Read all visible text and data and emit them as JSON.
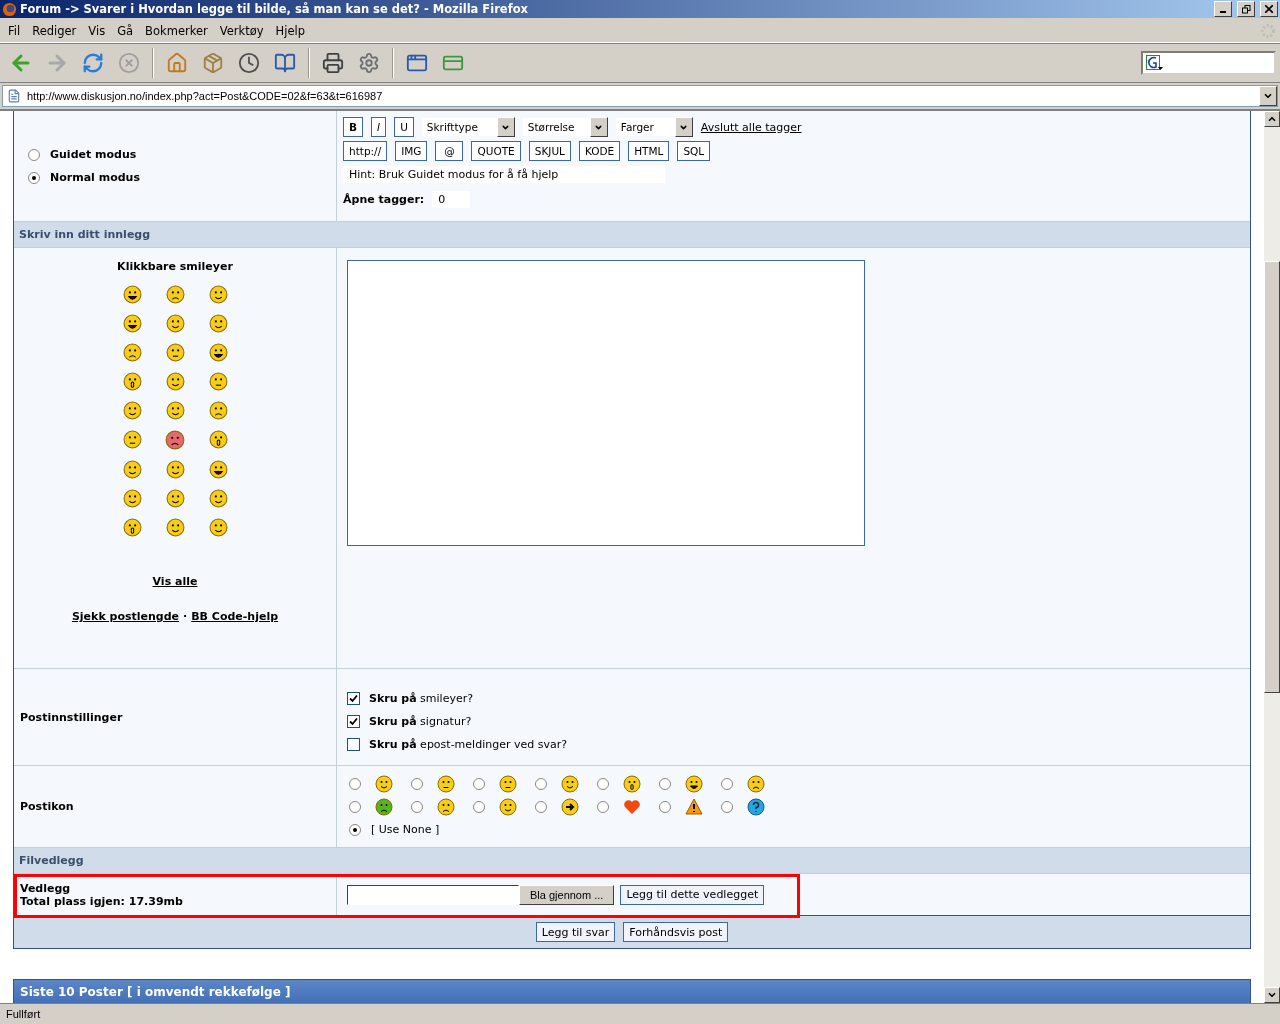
{
  "window": {
    "title": "Forum -> Svarer i Hvordan legge til bilde, så man kan se det? - Mozilla Firefox"
  },
  "menu": [
    "Fil",
    "Rediger",
    "Vis",
    "Gå",
    "Bokmerker",
    "Verktøy",
    "Hjelp"
  ],
  "address_bar": {
    "url": "http://www.diskusjon.no/index.php?act=Post&CODE=02&f=63&t=616987"
  },
  "modes": [
    {
      "label": "Guidet modus",
      "selected": false
    },
    {
      "label": "Normal modus",
      "selected": true
    }
  ],
  "format_buttons": [
    "B",
    "I",
    "U"
  ],
  "dropdowns": [
    "Skrifttype",
    "Størrelse",
    "Farger"
  ],
  "close_tags_link": "Avslutt alle tagger",
  "tag_buttons": [
    "http://",
    "IMG",
    "@",
    "QUOTE",
    "SKJUL",
    "KODE",
    "HTML",
    "SQL"
  ],
  "hint": "Hint: Bruk Guidet modus for å få hjelp",
  "open_tags": {
    "label": "Åpne tagger:",
    "value": "0"
  },
  "post_header": "Skriv inn ditt innlegg",
  "smileys": {
    "title": "Klikkbare smileyer",
    "show_all": "Vis alle"
  },
  "help_links": [
    "Sjekk postlengde",
    "·",
    "BB Code-hjelp"
  ],
  "post_settings": {
    "label": "Postinnstillinger",
    "options": [
      {
        "text": "**Skru på** smileyer?",
        "checked": true
      },
      {
        "text": "**Skru på** signatur?",
        "checked": true
      },
      {
        "text": "**Skru på** epost-meldinger ved svar?",
        "checked": false
      }
    ]
  },
  "post_icon": {
    "label": "Postikon",
    "icons": [
      {
        "selected": false
      },
      {
        "selected": false
      },
      {
        "selected": false
      },
      {
        "selected": false
      },
      {
        "selected": false
      },
      {
        "selected": false
      },
      {
        "selected": false
      },
      {
        "selected": false
      },
      {
        "selected": false
      },
      {
        "selected": false
      },
      {
        "selected": false
      },
      {
        "selected": false
      },
      {
        "selected": false
      },
      {
        "selected": false
      }
    ],
    "none": {
      "label": "[ Use None ]",
      "selected": true
    }
  },
  "attachments": {
    "header": "Filvedlegg",
    "label": "Vedlegg",
    "space": "Total plass igjen: 17.39mb",
    "browse": "Bla gjennom ...",
    "add": "Legg til dette vedlegget"
  },
  "submit_buttons": [
    "Legg til svar",
    "Forhåndsvis post"
  ],
  "recent_header": "Siste 10 Poster [ i omvendt rekkefølge ]",
  "status_bar": "Fullført"
}
